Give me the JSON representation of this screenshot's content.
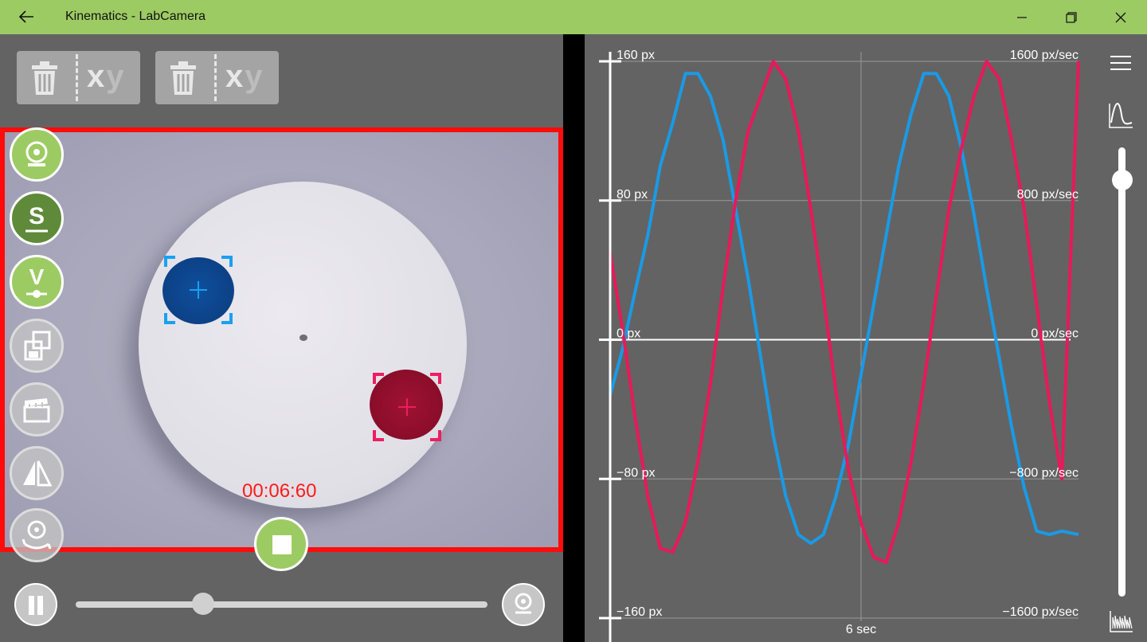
{
  "window": {
    "title": "Kinematics - LabCamera",
    "back_icon": "arrow-left-icon",
    "minimize_icon": "minimize-icon",
    "maximize_icon": "restore-icon",
    "close_icon": "close-icon"
  },
  "toolbar": {
    "clear_buttons": [
      {
        "x_label": "x",
        "y_label": "y",
        "icon": "trash-icon"
      },
      {
        "x_label": "x",
        "y_label": "y",
        "icon": "trash-icon"
      }
    ]
  },
  "video": {
    "timer": "00:06:60",
    "accent": "#ff0b0b"
  },
  "side_buttons": [
    {
      "name": "webcam-source-button",
      "icon": "webcam-icon",
      "style": "green"
    },
    {
      "name": "position-mode-button",
      "icon": "s-underline-icon",
      "style": "dkgreen"
    },
    {
      "name": "velocity-mode-button",
      "icon": "v-marker-icon",
      "style": "green"
    },
    {
      "name": "save-data-button",
      "icon": "save-export-icon",
      "style": "gray"
    },
    {
      "name": "video-clip-button",
      "icon": "clapperboard-icon",
      "style": "gray"
    },
    {
      "name": "mirror-button",
      "icon": "mirror-flip-icon",
      "style": "gray"
    },
    {
      "name": "switch-camera-button",
      "icon": "camera-switch-icon",
      "style": "gray"
    }
  ],
  "playback": {
    "slider_fraction": 0.31,
    "pause_icon": "pause-icon",
    "camera_icon": "webcam-icon"
  },
  "sidebar_controls": {
    "menu_icon": "hamburger-menu-icon",
    "graph_icon": "wave-graph-icon",
    "signal_icon": "signal-wave-icon",
    "zoom_fraction": 0.05
  },
  "chart_data": {
    "type": "line",
    "y_left_ticks": [
      "160 px",
      "80 px",
      "0 px",
      "−80 px",
      "−160 px"
    ],
    "y_right_ticks": [
      "1600 px/sec",
      "800 px/sec",
      "0 px/sec",
      "−800 px/sec",
      "−1600 px/sec"
    ],
    "ylim": [
      -160,
      160
    ],
    "xlim": [
      0,
      11.2
    ],
    "x_tick": {
      "value": 6,
      "label": "6 sec"
    },
    "grid": true,
    "series": [
      {
        "color": "#1a9ae6",
        "x": [
          0,
          0.3,
          0.6,
          0.9,
          1.2,
          1.5,
          1.8,
          2.1,
          2.4,
          2.7,
          3.0,
          3.3,
          3.6,
          3.9,
          4.2,
          4.5,
          4.8,
          5.1,
          5.4,
          5.7,
          6.0,
          6.3,
          6.6,
          6.9,
          7.2,
          7.5,
          7.8,
          8.1,
          8.4,
          8.7,
          9.0,
          9.3,
          9.6,
          9.9,
          10.2,
          10.5,
          10.8,
          11.2
        ],
        "y": [
          -32,
          -5,
          28,
          60,
          100,
          125,
          153,
          153,
          140,
          115,
          75,
          35,
          -10,
          -55,
          -90,
          -112,
          -117,
          -112,
          -90,
          -60,
          -20,
          20,
          60,
          100,
          130,
          153,
          153,
          140,
          110,
          72,
          30,
          -10,
          -50,
          -85,
          -110,
          -112,
          -110,
          -112
        ]
      },
      {
        "color": "#e8195a",
        "x": [
          0,
          0.3,
          0.6,
          0.9,
          1.2,
          1.5,
          1.8,
          2.1,
          2.4,
          2.7,
          3.0,
          3.3,
          3.6,
          3.9,
          4.2,
          4.5,
          4.8,
          5.1,
          5.4,
          5.7,
          6.0,
          6.3,
          6.6,
          6.9,
          7.2,
          7.5,
          7.8,
          8.1,
          8.4,
          8.7,
          9.0,
          9.3,
          9.6,
          9.9,
          10.2,
          10.5,
          10.8,
          11.2
        ],
        "y": [
          50,
          5,
          -45,
          -90,
          -120,
          -122,
          -105,
          -70,
          -25,
          30,
          80,
          120,
          140,
          160,
          150,
          120,
          75,
          25,
          -30,
          -75,
          -105,
          -125,
          -128,
          -105,
          -70,
          -25,
          25,
          75,
          110,
          140,
          160,
          150,
          115,
          75,
          20,
          -35,
          -80,
          160
        ]
      }
    ]
  }
}
